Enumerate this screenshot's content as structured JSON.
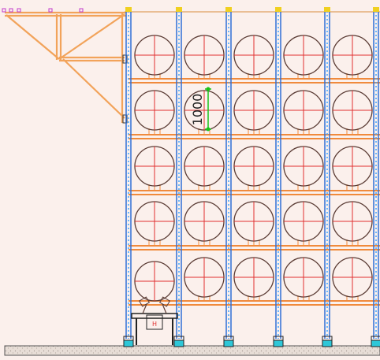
{
  "colors": {
    "background": "#fbf0ec",
    "upright_blue": "#2f6fd6",
    "upright_dots": "#3aa3ff",
    "beam_orange": "#f08a3c",
    "truss_orange": "#f2a35a",
    "roll_outline": "#5a3b34",
    "crosshair_red": "#e03131",
    "dim_green": "#19c219",
    "cap_yellow": "#f0d020",
    "base_cyan": "#2ec7d8",
    "floor_fill": "#e7ddd6",
    "marker_magenta": "#c03acb"
  },
  "dimension": {
    "text": "1000"
  },
  "rack": {
    "bays": 5,
    "levels": 5
  },
  "loader": {
    "label": "H"
  }
}
